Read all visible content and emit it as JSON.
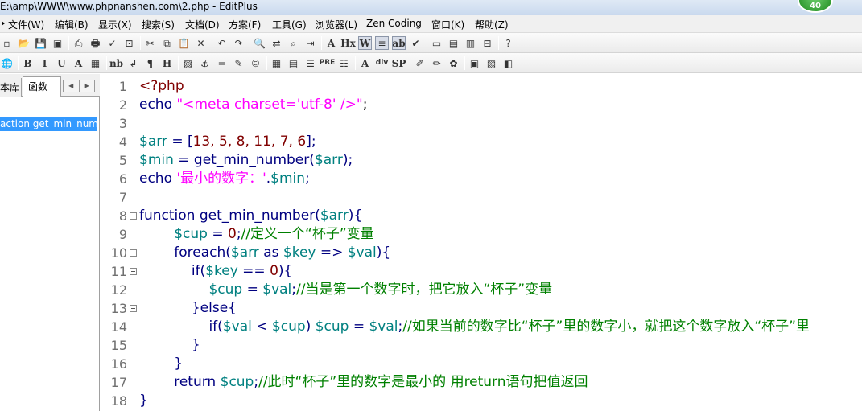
{
  "window": {
    "title": "E:\\amp\\WWW\\www.phpnanshen.com\\2.php - EditPlus",
    "badge": "40"
  },
  "menu": [
    {
      "label": "文件(W)"
    },
    {
      "label": "编辑(B)"
    },
    {
      "label": "显示(X)"
    },
    {
      "label": "搜索(S)"
    },
    {
      "label": "文档(D)"
    },
    {
      "label": "方案(F)"
    },
    {
      "label": "工具(G)"
    },
    {
      "label": "浏览器(L)"
    },
    {
      "label": "Zen Coding"
    },
    {
      "label": "窗口(K)"
    },
    {
      "label": "帮助(Z)"
    }
  ],
  "toolbar1": [
    {
      "icon": "new-file-icon",
      "glyph": "▫"
    },
    {
      "icon": "open-file-icon",
      "glyph": "📂"
    },
    {
      "icon": "save-icon",
      "glyph": "💾"
    },
    {
      "icon": "save-all-icon",
      "glyph": "▣"
    },
    {
      "icon": "print-preview-icon",
      "glyph": "⎙"
    },
    {
      "icon": "print-icon",
      "glyph": "🖶"
    },
    {
      "icon": "spell-check-icon",
      "glyph": "✓"
    },
    {
      "icon": "browser-icon",
      "glyph": "⊡"
    },
    {
      "icon": "cut-icon",
      "glyph": "✂"
    },
    {
      "icon": "copy-icon",
      "glyph": "⧉"
    },
    {
      "icon": "paste-icon",
      "glyph": "📋"
    },
    {
      "icon": "delete-icon",
      "glyph": "✕"
    },
    {
      "icon": "undo-icon",
      "glyph": "↶"
    },
    {
      "icon": "redo-icon",
      "glyph": "↷"
    },
    {
      "icon": "find-icon",
      "glyph": "🔍"
    },
    {
      "icon": "replace-icon",
      "glyph": "⇄"
    },
    {
      "icon": "find-in-files-icon",
      "glyph": "⌕"
    },
    {
      "icon": "goto-icon",
      "glyph": "⇥"
    },
    {
      "icon": "font-icon",
      "glyph": "A"
    },
    {
      "icon": "hex-icon",
      "glyph": "Hx"
    },
    {
      "icon": "word-wrap-icon",
      "glyph": "W"
    },
    {
      "icon": "line-number-icon",
      "glyph": "≡"
    },
    {
      "icon": "ruler-icon",
      "glyph": "ab"
    },
    {
      "icon": "check-icon",
      "glyph": "✔"
    },
    {
      "icon": "window-icon",
      "glyph": "▭"
    },
    {
      "icon": "cliptext-icon",
      "glyph": "▤"
    },
    {
      "icon": "directory-icon",
      "glyph": "▥"
    },
    {
      "icon": "output-icon",
      "glyph": "⊟"
    },
    {
      "icon": "help-icon",
      "glyph": "?"
    }
  ],
  "toolbar2": [
    {
      "icon": "globe-icon",
      "glyph": "🌐"
    },
    {
      "icon": "bold-icon",
      "glyph": "B"
    },
    {
      "icon": "italic-icon",
      "glyph": "I"
    },
    {
      "icon": "underline-icon",
      "glyph": "U"
    },
    {
      "icon": "font-color-icon",
      "glyph": "A"
    },
    {
      "icon": "color-grid-icon",
      "glyph": "▦"
    },
    {
      "icon": "nbsp-icon",
      "glyph": "nb"
    },
    {
      "icon": "br-icon",
      "glyph": "↲"
    },
    {
      "icon": "paragraph-icon",
      "glyph": "¶"
    },
    {
      "icon": "heading-icon",
      "glyph": "H"
    },
    {
      "icon": "image-icon",
      "glyph": "▨"
    },
    {
      "icon": "anchor-icon",
      "glyph": "⚓"
    },
    {
      "icon": "hr-icon",
      "glyph": "═"
    },
    {
      "icon": "comment-icon",
      "glyph": "✎"
    },
    {
      "icon": "entity-icon",
      "glyph": "©"
    },
    {
      "icon": "table-icon",
      "glyph": "▦"
    },
    {
      "icon": "form-icon",
      "glyph": "▤"
    },
    {
      "icon": "center-icon",
      "glyph": "☰"
    },
    {
      "icon": "pre-icon",
      "glyph": "PRE"
    },
    {
      "icon": "list-icon",
      "glyph": "☷"
    },
    {
      "icon": "font-tag-icon",
      "glyph": "A"
    },
    {
      "icon": "div-icon",
      "glyph": "div"
    },
    {
      "icon": "span-icon",
      "glyph": "SP"
    },
    {
      "icon": "style-icon",
      "glyph": "✐"
    },
    {
      "icon": "pencil-icon",
      "glyph": "✏"
    },
    {
      "icon": "script-icon",
      "glyph": "✿"
    },
    {
      "icon": "block-icon",
      "glyph": "▣"
    },
    {
      "icon": "frame-icon",
      "glyph": "▧"
    },
    {
      "icon": "preview-icon",
      "glyph": "◧"
    }
  ],
  "sidebar": {
    "tab_library": "本库",
    "tab_functions": "函数",
    "items": [
      {
        "label": "action get_min_number"
      }
    ]
  },
  "editor": {
    "lines": [
      {
        "n": "1",
        "fold": false,
        "tokens": [
          {
            "t": "<?php",
            "c": "#800000"
          }
        ]
      },
      {
        "n": "2",
        "fold": false,
        "tokens": [
          {
            "t": "echo ",
            "c": "#000080"
          },
          {
            "t": "\"<meta charset='utf-8' />\"",
            "c": "#ff00ff"
          },
          {
            "t": ";",
            "c": "#000000"
          }
        ]
      },
      {
        "n": "3",
        "fold": false,
        "tokens": []
      },
      {
        "n": "4",
        "fold": false,
        "tokens": [
          {
            "t": "$arr",
            "c": "#008080"
          },
          {
            "t": " = [",
            "c": "#000080"
          },
          {
            "t": "13, 5, 8, 11, 7, 6",
            "c": "#800000"
          },
          {
            "t": "];",
            "c": "#000080"
          }
        ]
      },
      {
        "n": "5",
        "fold": false,
        "tokens": [
          {
            "t": "$min",
            "c": "#008080"
          },
          {
            "t": " = get_min_number(",
            "c": "#000080"
          },
          {
            "t": "$arr",
            "c": "#008080"
          },
          {
            "t": ");",
            "c": "#000080"
          }
        ]
      },
      {
        "n": "6",
        "fold": false,
        "tokens": [
          {
            "t": "echo ",
            "c": "#000080"
          },
          {
            "t": "'最小的数字：'",
            "c": "#ff00ff"
          },
          {
            "t": ".",
            "c": "#000080"
          },
          {
            "t": "$min",
            "c": "#008080"
          },
          {
            "t": ";",
            "c": "#000080"
          }
        ]
      },
      {
        "n": "7",
        "fold": false,
        "tokens": []
      },
      {
        "n": "8",
        "fold": true,
        "tokens": [
          {
            "t": "function get_min_number(",
            "c": "#000080"
          },
          {
            "t": "$arr",
            "c": "#008080"
          },
          {
            "t": "){",
            "c": "#000080"
          }
        ]
      },
      {
        "n": "9",
        "fold": false,
        "tokens": [
          {
            "t": "        ",
            "c": "#000"
          },
          {
            "t": "$cup",
            "c": "#008080"
          },
          {
            "t": " = ",
            "c": "#000080"
          },
          {
            "t": "0",
            "c": "#800000"
          },
          {
            "t": ";",
            "c": "#000080"
          },
          {
            "t": "//定义一个“杯子”变量",
            "c": "#008000"
          }
        ]
      },
      {
        "n": "10",
        "fold": true,
        "tokens": [
          {
            "t": "        foreach(",
            "c": "#000080"
          },
          {
            "t": "$arr",
            "c": "#008080"
          },
          {
            "t": " as ",
            "c": "#000080"
          },
          {
            "t": "$key",
            "c": "#008080"
          },
          {
            "t": " => ",
            "c": "#000080"
          },
          {
            "t": "$val",
            "c": "#008080"
          },
          {
            "t": "){",
            "c": "#000080"
          }
        ]
      },
      {
        "n": "11",
        "fold": true,
        "tokens": [
          {
            "t": "            if(",
            "c": "#000080"
          },
          {
            "t": "$key",
            "c": "#008080"
          },
          {
            "t": " == ",
            "c": "#000080"
          },
          {
            "t": "0",
            "c": "#800000"
          },
          {
            "t": "){",
            "c": "#000080"
          }
        ]
      },
      {
        "n": "12",
        "fold": false,
        "tokens": [
          {
            "t": "                ",
            "c": "#000"
          },
          {
            "t": "$cup",
            "c": "#008080"
          },
          {
            "t": " = ",
            "c": "#000080"
          },
          {
            "t": "$val",
            "c": "#008080"
          },
          {
            "t": ";",
            "c": "#000080"
          },
          {
            "t": "//当是第一个数字时，把它放入“杯子”变量",
            "c": "#008000"
          }
        ]
      },
      {
        "n": "13",
        "fold": true,
        "tokens": [
          {
            "t": "            }else{",
            "c": "#000080"
          }
        ]
      },
      {
        "n": "14",
        "fold": false,
        "tokens": [
          {
            "t": "                if(",
            "c": "#000080"
          },
          {
            "t": "$val",
            "c": "#008080"
          },
          {
            "t": " < ",
            "c": "#000080"
          },
          {
            "t": "$cup",
            "c": "#008080"
          },
          {
            "t": ") ",
            "c": "#000080"
          },
          {
            "t": "$cup",
            "c": "#008080"
          },
          {
            "t": " = ",
            "c": "#000080"
          },
          {
            "t": "$val",
            "c": "#008080"
          },
          {
            "t": ";",
            "c": "#000080"
          },
          {
            "t": "//如果当前的数字比“杯子”里的数字小，就把这个数字放入“杯子”里",
            "c": "#008000"
          }
        ]
      },
      {
        "n": "15",
        "fold": false,
        "tokens": [
          {
            "t": "            }",
            "c": "#000080"
          }
        ]
      },
      {
        "n": "16",
        "fold": false,
        "tokens": [
          {
            "t": "        }",
            "c": "#000080"
          }
        ]
      },
      {
        "n": "17",
        "fold": false,
        "tokens": [
          {
            "t": "        return ",
            "c": "#000080"
          },
          {
            "t": "$cup",
            "c": "#008080"
          },
          {
            "t": ";",
            "c": "#000080"
          },
          {
            "t": "//此时“杯子”里的数字是最小的 用return语句把值返回",
            "c": "#008000"
          }
        ]
      },
      {
        "n": "18",
        "fold": false,
        "tokens": [
          {
            "t": "}",
            "c": "#000080"
          }
        ]
      }
    ]
  }
}
